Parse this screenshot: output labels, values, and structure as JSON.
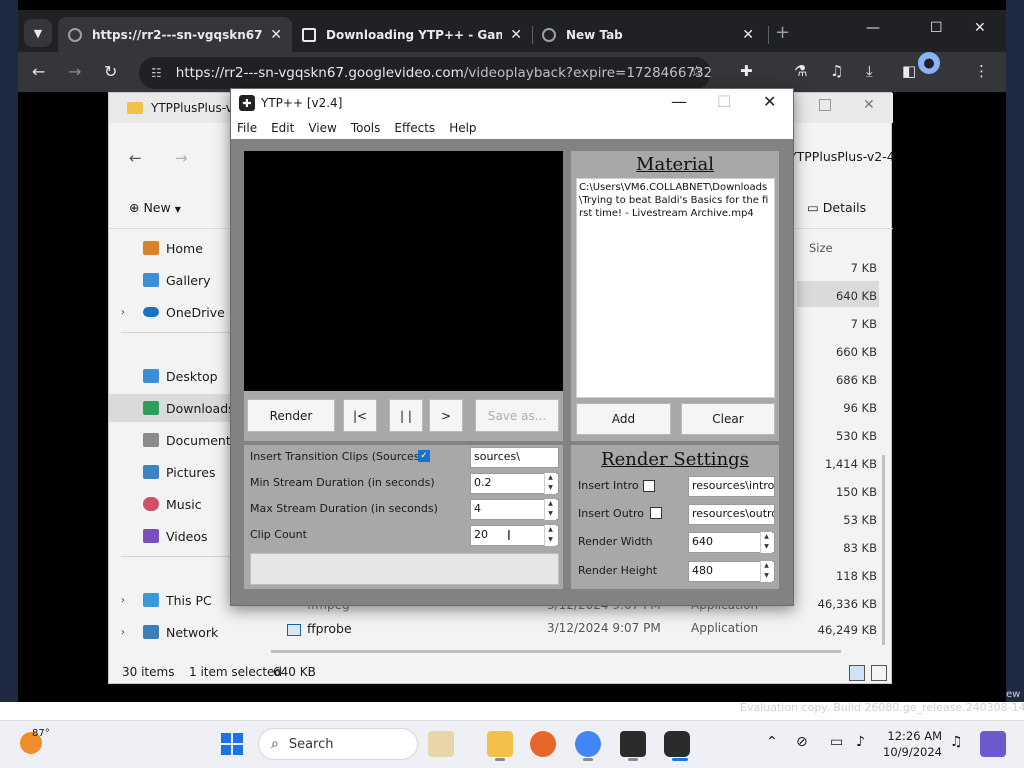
{
  "browser": {
    "tabs": [
      {
        "title": "https://rr2---sn-vgqskn67.googlevideo.com/videoplayback"
      },
      {
        "title": "Downloading YTP++ - Game Jolt"
      },
      {
        "title": "New Tab"
      }
    ],
    "new_tab_label": "+",
    "url_host": "https://rr2---sn-vgqskn67.googlevideo.com",
    "url_path": "/videoplayback?expire=1728466732..."
  },
  "explorer": {
    "title": "YTPPlusPlus-v2-4",
    "breadcrumb": "YTPPlusPlus-v2-4",
    "new_label": "New",
    "details_label": "Details",
    "size_header": "Size",
    "nav": [
      {
        "label": "Home"
      },
      {
        "label": "Gallery"
      },
      {
        "label": "OneDrive"
      },
      {
        "label": "Desktop"
      },
      {
        "label": "Downloads"
      },
      {
        "label": "Documents"
      },
      {
        "label": "Pictures"
      },
      {
        "label": "Music"
      },
      {
        "label": "Videos"
      },
      {
        "label": "This PC"
      },
      {
        "label": "Network"
      }
    ],
    "sizes": [
      "7 KB",
      "640 KB",
      "7 KB",
      "660 KB",
      "686 KB",
      "96 KB",
      "530 KB",
      "1,414 KB",
      "150 KB",
      "53 KB",
      "83 KB",
      "118 KB",
      "46,336 KB",
      "46,249 KB"
    ],
    "partial_row": {
      "name": "ffmpeg",
      "date": "3/12/2024 9:07 PM",
      "type": "Application"
    },
    "last_row": {
      "name": "ffprobe",
      "date": "3/12/2024 9:07 PM",
      "type": "Application",
      "size": "46,249 KB"
    },
    "status": {
      "items": "30 items",
      "selected": "1 item selected",
      "size": "640 KB"
    }
  },
  "ytp": {
    "title": "YTP++ [v2.4]",
    "menu": [
      "File",
      "Edit",
      "View",
      "Tools",
      "Effects",
      "Help"
    ],
    "buttons": {
      "render": "Render",
      "first": "|<",
      "pause": "| |",
      "next": ">",
      "save_as": "Save as..."
    },
    "material": {
      "title": "Material",
      "items": [
        "C:\\Users\\VM6.COLLABNET\\Downloads\\Trying to beat Baldi's Basics for the first time! - Livestream Archive.mp4"
      ],
      "add_label": "Add",
      "clear_label": "Clear"
    },
    "settings": {
      "insert_transition_label": "Insert Transition Clips (Sources)",
      "insert_transition_checked": true,
      "sources_path": "sources\\",
      "min_label": "Min Stream Duration (in seconds)",
      "min_value": "0.2",
      "max_label": "Max Stream Duration (in seconds)",
      "max_value": "4",
      "clip_label": "Clip Count",
      "clip_value": "20"
    },
    "render_settings": {
      "title": "Render Settings",
      "intro_label": "Insert Intro",
      "intro_path": "resources\\intro.mp4",
      "outro_label": "Insert Outro",
      "outro_path": "resources\\outro.mp4",
      "width_label": "Render Width",
      "width_value": "640",
      "height_label": "Render Height",
      "height_value": "480"
    }
  },
  "desktop": {
    "watermark": "Evaluation copy. Build 26080.ge_release.240308-1400",
    "watermark_edge": "ew"
  },
  "taskbar": {
    "temperature": "87°",
    "search_label": "Search",
    "time": "12:26 AM",
    "date": "10/9/2024"
  }
}
